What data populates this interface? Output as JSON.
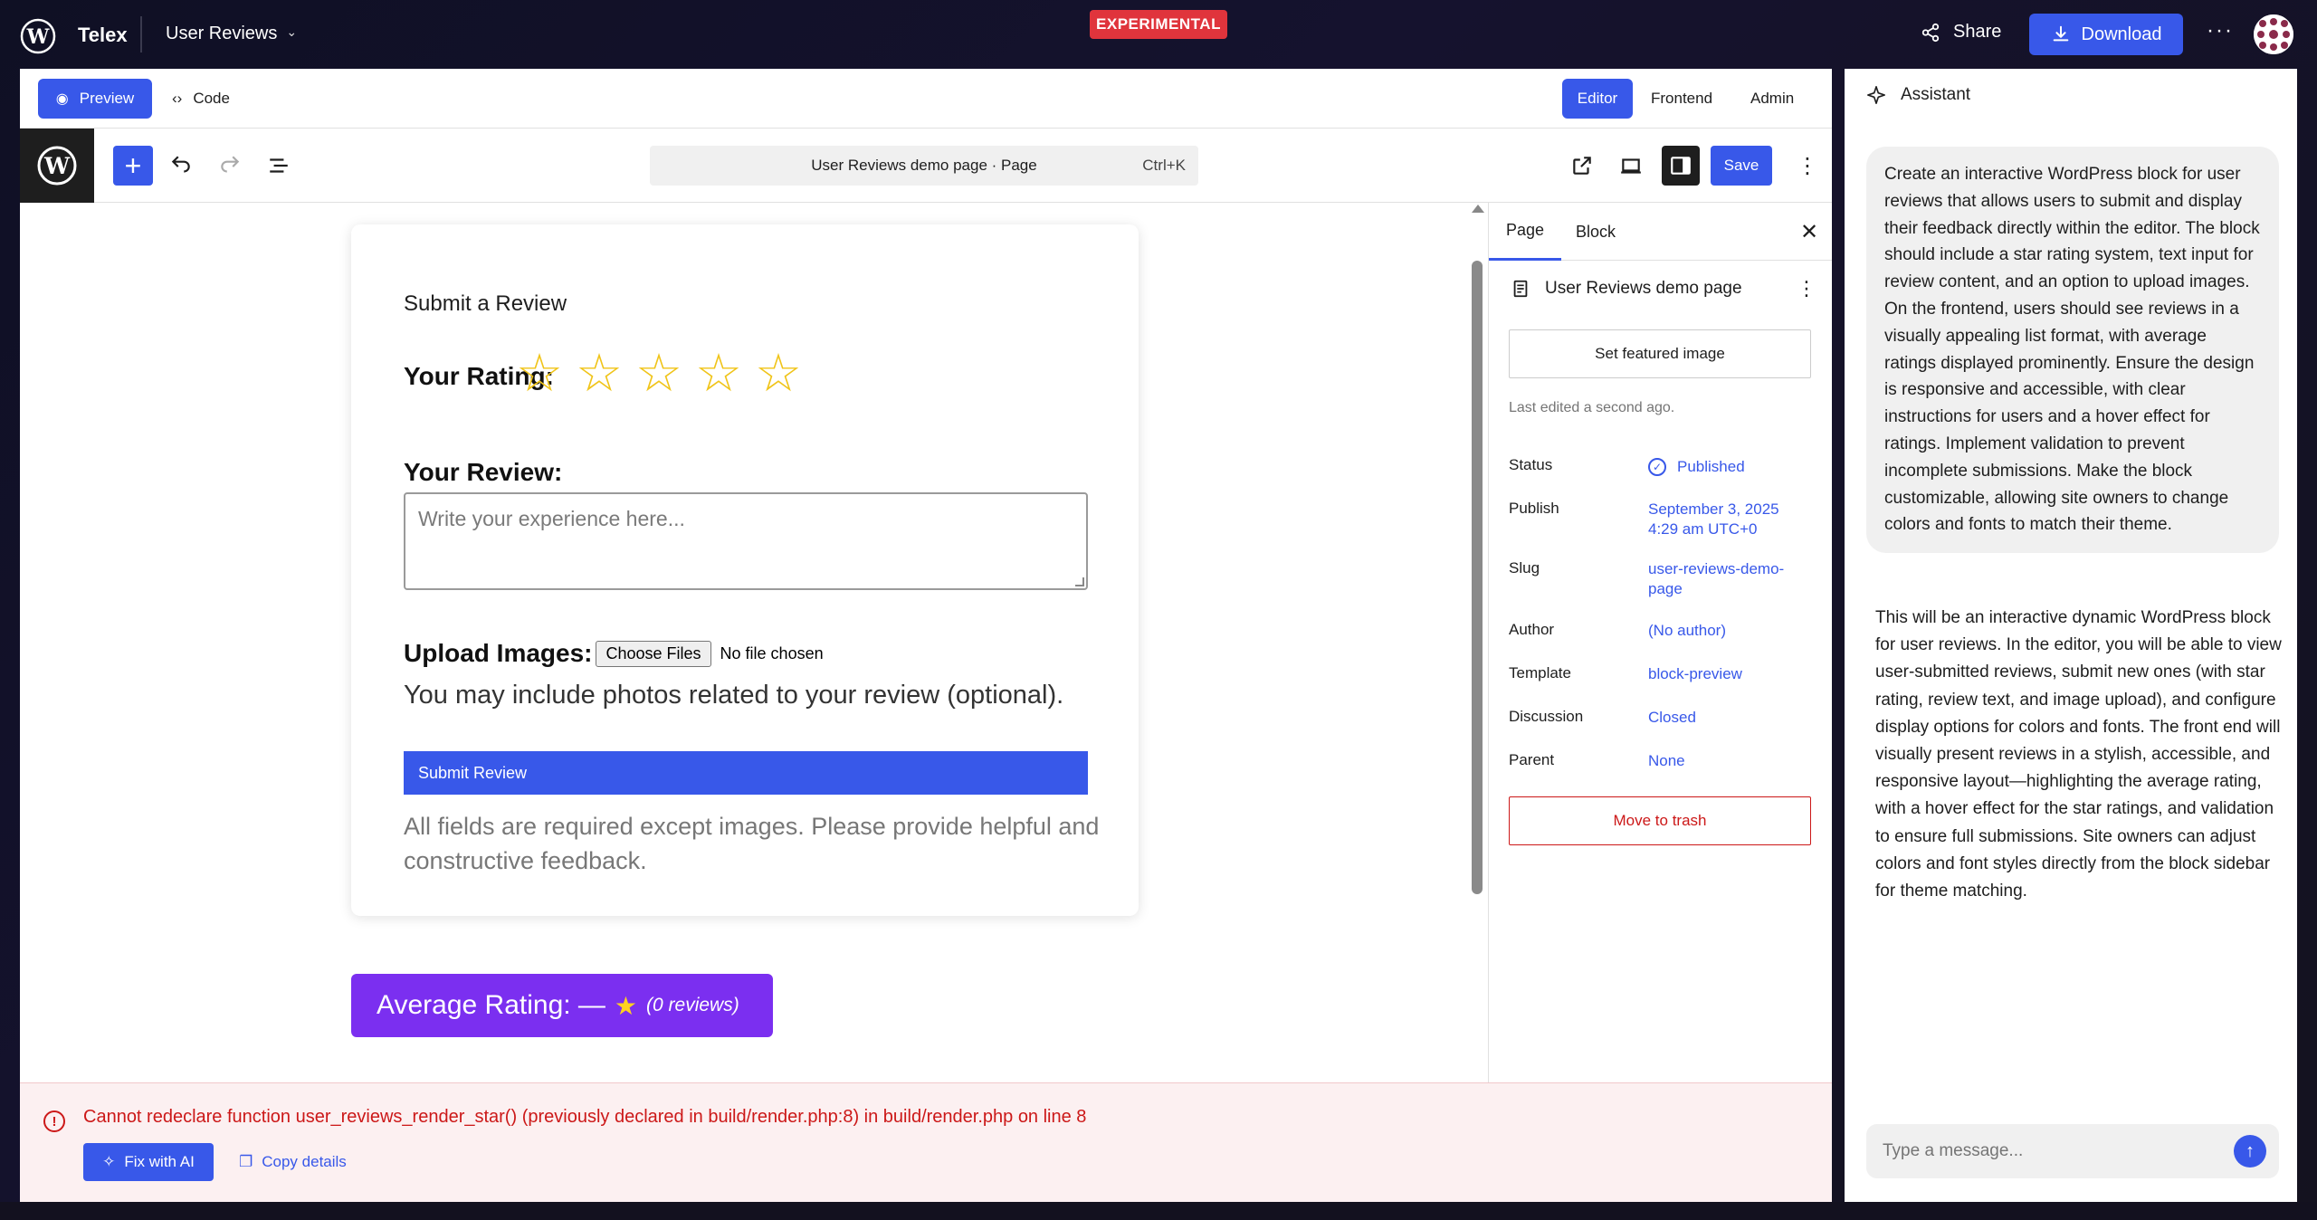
{
  "app": {
    "brand": "Telex",
    "project": "User Reviews",
    "badge": "EXPERIMENTAL",
    "share": "Share",
    "download": "Download"
  },
  "topbar": {
    "preview": "Preview",
    "code": "Code",
    "modes": [
      "Editor",
      "Frontend",
      "Admin"
    ]
  },
  "toolbar": {
    "command_title": "User Reviews demo page · Page",
    "command_shortcut": "Ctrl+K",
    "save": "Save"
  },
  "form": {
    "title": "Submit a Review",
    "rating_label": "Your Rating:",
    "stars": 5,
    "review_label": "Your Review:",
    "review_placeholder": "Write your experience here...",
    "upload_label": "Upload Images:",
    "choose_files": "Choose Files",
    "no_file": "No file chosen",
    "upload_hint": "You may include photos related to your review (optional).",
    "submit": "Submit Review",
    "fine_print": "All fields are required except images. Please provide helpful and constructive feedback."
  },
  "average": {
    "label": "Average Rating: —",
    "star": "★",
    "count": "(0 reviews)"
  },
  "error": {
    "message": "Cannot redeclare function user_reviews_render_star() (previously declared in build/render.php:8) in build/render.php on line 8",
    "fix": "Fix with AI",
    "copy": "Copy details"
  },
  "settings": {
    "tabs": [
      "Page",
      "Block"
    ],
    "doc_title": "User Reviews demo page",
    "featured": "Set featured image",
    "last_edited": "Last edited a second ago.",
    "rows": [
      {
        "label": "Status",
        "value": "Published"
      },
      {
        "label": "Publish",
        "value": "September 3, 2025 4:29 am UTC+0"
      },
      {
        "label": "Slug",
        "value": "user-reviews-demo-page"
      },
      {
        "label": "Author",
        "value": "(No author)"
      },
      {
        "label": "Template",
        "value": "block-preview"
      },
      {
        "label": "Discussion",
        "value": "Closed"
      },
      {
        "label": "Parent",
        "value": "None"
      }
    ],
    "trash": "Move to trash"
  },
  "assistant": {
    "title": "Assistant",
    "prompt": "Create an interactive WordPress block for user reviews that allows users to submit and display their feedback directly within the editor. The block should include a star rating system, text input for review content, and an option to upload images. On the frontend, users should see reviews in a visually appealing list format, with average ratings displayed prominently. Ensure the design is responsive and accessible, with clear instructions for users and a hover effect for ratings. Implement validation to prevent incomplete submissions. Make the block customizable, allowing site owners to change colors and fonts to match their theme.",
    "reply": "This will be an interactive dynamic WordPress block for user reviews. In the editor, you will be able to view user-submitted reviews, submit new ones (with star rating, review text, and image upload), and configure display options for colors and fonts. The front end will visually present reviews in a stylish, accessible, and responsive layout—highlighting the average rating, with a hover effect for the star ratings, and validation to ensure full submissions. Site owners can adjust colors and font styles directly from the block sidebar for theme matching.",
    "input_placeholder": "Type a message..."
  },
  "colors": {
    "accent": "#3858e9",
    "average_button": "#7b2ff0",
    "star": "#f0c419",
    "error": "#cc1818",
    "badge": "#e0343c"
  }
}
